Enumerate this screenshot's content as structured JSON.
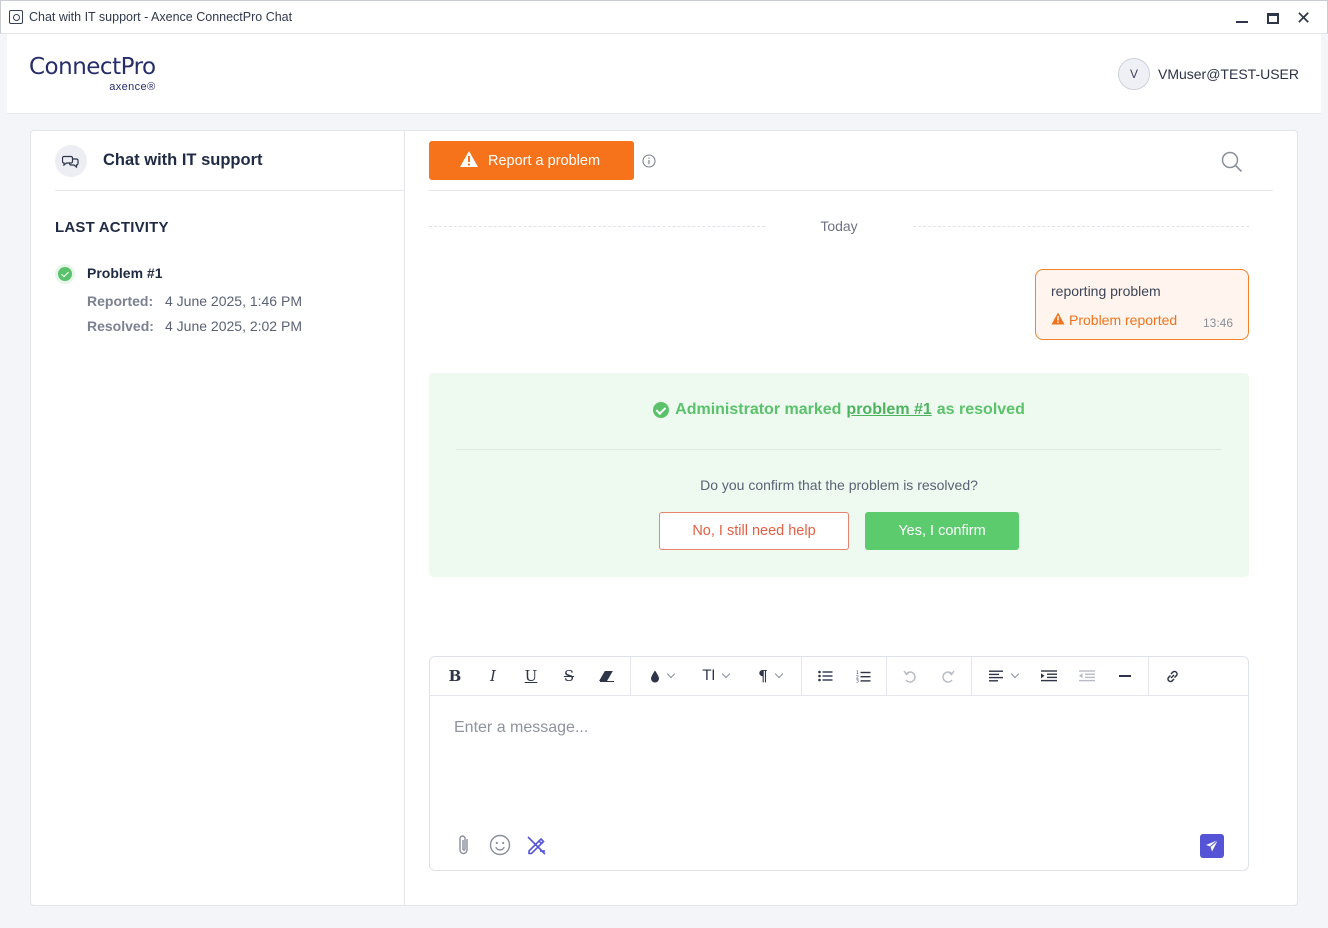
{
  "window": {
    "title": "Chat with IT support - Axence ConnectPro Chat"
  },
  "header": {
    "logo_main": "ConnectPro",
    "logo_sub": "axence®",
    "avatar_initial": "V",
    "user_name": "VMuser@TEST-USER"
  },
  "sidebar": {
    "title": "Chat with IT support",
    "section_title": "LAST ACTIVITY",
    "items": [
      {
        "title": "Problem #1",
        "reported_label": "Reported:",
        "reported_value": "4 June 2025, 1:46 PM",
        "resolved_label": "Resolved:",
        "resolved_value": "4 June 2025, 2:02 PM"
      }
    ]
  },
  "chat": {
    "report_button": "Report a problem",
    "day_label": "Today",
    "messages": [
      {
        "text": "reporting problem",
        "status": "Problem reported",
        "time": "13:46"
      }
    ],
    "resolution": {
      "prefix": "Administrator marked",
      "link": "problem #1",
      "suffix": "as resolved",
      "question": "Do you confirm that the problem is resolved?",
      "no_button": "No, I still need help",
      "yes_button": "Yes, I confirm"
    }
  },
  "editor": {
    "placeholder": "Enter a message...",
    "toolbar": {
      "bold": "B",
      "italic": "I",
      "underline": "U",
      "strike": "S",
      "heading": "TI",
      "paragraph": "¶"
    }
  },
  "colors": {
    "accent_orange": "#f6731c",
    "success_green": "#5ccb6e",
    "send_purple": "#5554d6",
    "danger_red": "#e35f43"
  }
}
